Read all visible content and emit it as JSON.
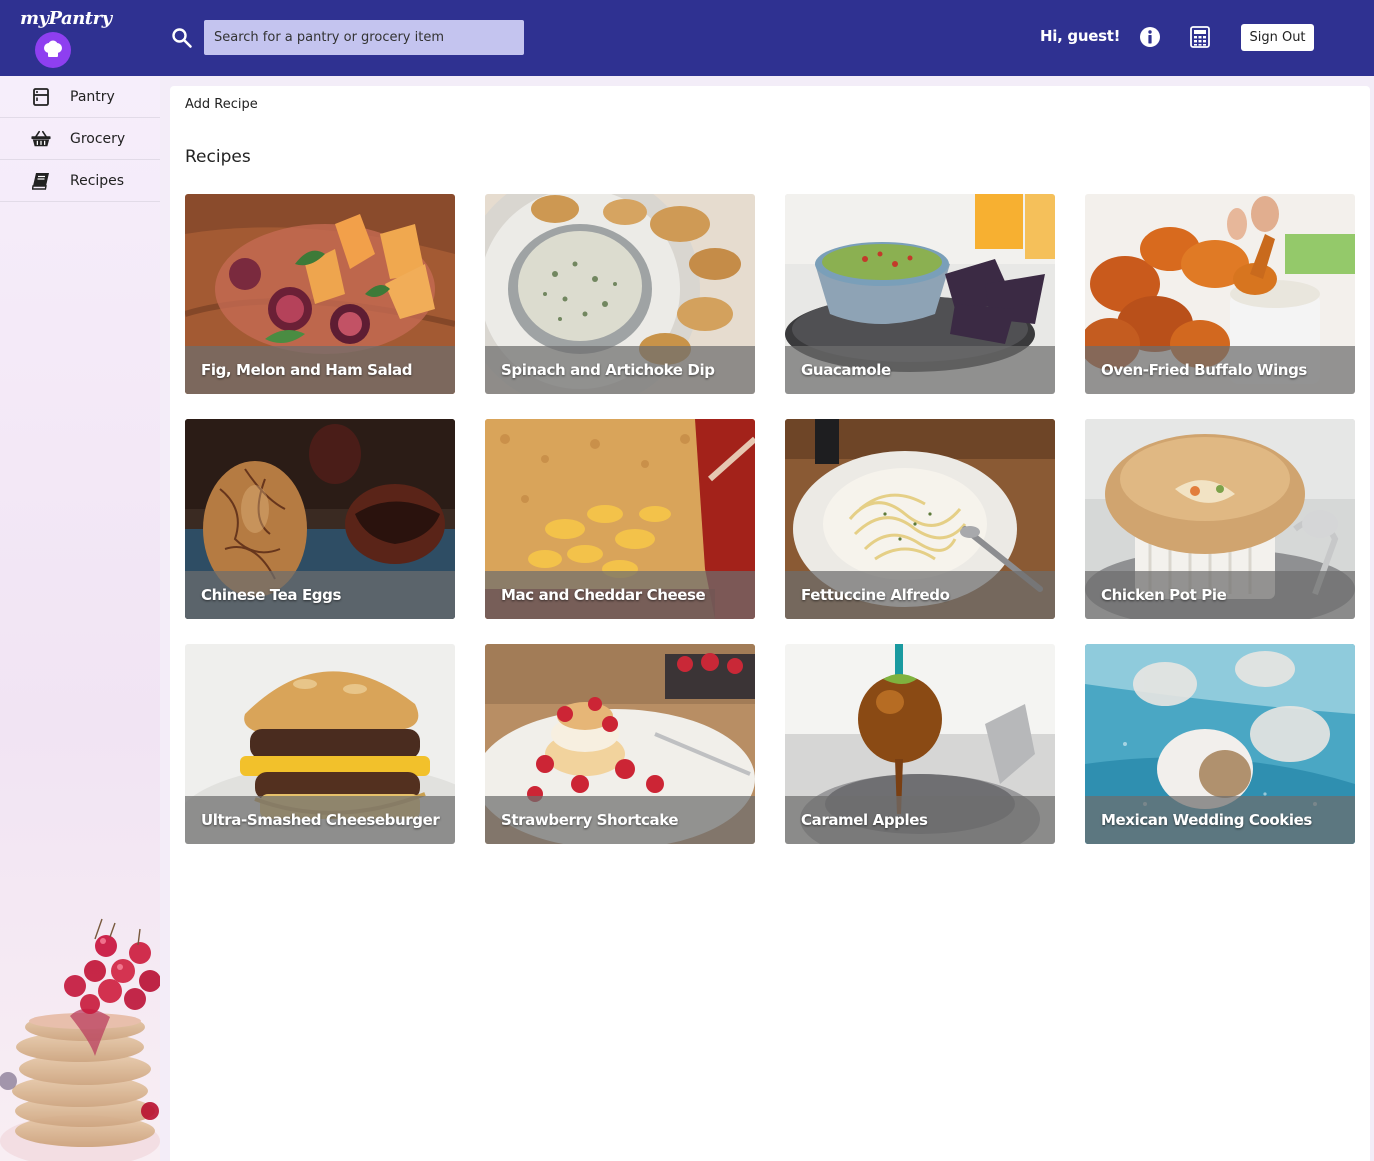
{
  "app": {
    "logo_text": "myPantry",
    "search_placeholder": "Search for a pantry or grocery item",
    "greeting": "Hi,  guest!",
    "sign_out_label": "Sign Out",
    "header_color": "#2f3191"
  },
  "sidebar": {
    "items": [
      {
        "label": "Pantry",
        "icon": "pantry-icon"
      },
      {
        "label": "Grocery",
        "icon": "basket-icon"
      },
      {
        "label": "Recipes",
        "icon": "book-icon"
      }
    ]
  },
  "main": {
    "add_recipe_label": "Add Recipe",
    "section_title": "Recipes",
    "recipes": [
      {
        "title": "Fig, Melon and Ham Salad"
      },
      {
        "title": "Spinach and Artichoke Dip"
      },
      {
        "title": "Guacamole"
      },
      {
        "title": "Oven-Fried Buffalo Wings"
      },
      {
        "title": "Chinese Tea Eggs"
      },
      {
        "title": "Mac and Cheddar Cheese"
      },
      {
        "title": "Fettuccine Alfredo"
      },
      {
        "title": "Chicken Pot Pie"
      },
      {
        "title": "Ultra-Smashed Cheeseburger"
      },
      {
        "title": "Strawberry Shortcake"
      },
      {
        "title": "Caramel Apples"
      },
      {
        "title": "Mexican Wedding Cookies"
      }
    ]
  }
}
